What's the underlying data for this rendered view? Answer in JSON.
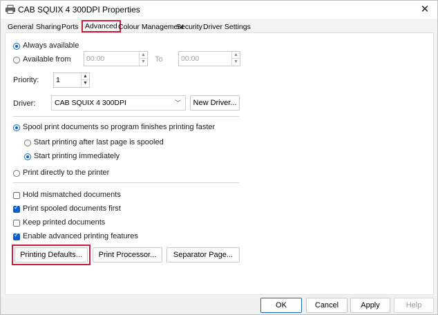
{
  "window": {
    "title": "CAB SQUIX 4 300DPI Properties",
    "close_glyph": "✕"
  },
  "tabs": [
    {
      "label": "General",
      "active": false
    },
    {
      "label": "Sharing",
      "active": false
    },
    {
      "label": "Ports",
      "active": false
    },
    {
      "label": "Advanced",
      "active": true
    },
    {
      "label": "Colour Management",
      "active": false
    },
    {
      "label": "Security",
      "active": false
    },
    {
      "label": "Driver Settings",
      "active": false
    }
  ],
  "availability": {
    "always_label": "Always available",
    "always_selected": true,
    "from_label": "Available from",
    "from_value": "00:00",
    "to_label": "To",
    "to_value": "00:00"
  },
  "priority": {
    "label": "Priority:",
    "value": "1"
  },
  "driver": {
    "label": "Driver:",
    "selected": "CAB SQUIX 4 300DPI",
    "new_driver_button": "New Driver..."
  },
  "spooling": {
    "spool_label": "Spool print documents so program finishes printing faster",
    "spool_selected": true,
    "after_last_label": "Start printing after last page is spooled",
    "after_last_selected": false,
    "immediately_label": "Start printing immediately",
    "immediately_selected": true,
    "direct_label": "Print directly to the printer",
    "direct_selected": false
  },
  "options": [
    {
      "label": "Hold mismatched documents",
      "checked": false
    },
    {
      "label": "Print spooled documents first",
      "checked": true
    },
    {
      "label": "Keep printed documents",
      "checked": false
    },
    {
      "label": "Enable advanced printing features",
      "checked": true
    }
  ],
  "action_buttons": {
    "printing_defaults": "Printing Defaults...",
    "print_processor": "Print Processor...",
    "separator_page": "Separator Page..."
  },
  "footer": {
    "ok": "OK",
    "cancel": "Cancel",
    "apply": "Apply",
    "help": "Help"
  },
  "colors": {
    "accent": "#0a60c8",
    "highlight": "#d01a3c"
  }
}
